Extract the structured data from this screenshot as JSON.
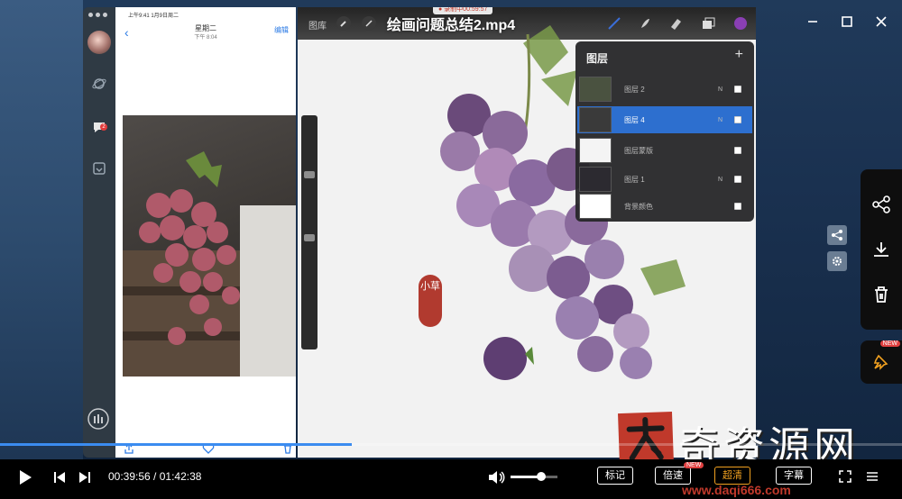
{
  "window": {
    "title": "绘画问题总结2.mp4",
    "controls": [
      "minimize-icon",
      "maximize-icon",
      "close-icon"
    ]
  },
  "ipad": {
    "status_bar": "上午9:41  1月9日周二",
    "notes": {
      "back": "‹",
      "date": "星期二",
      "time": "下午 8:04",
      "edit": "编辑"
    }
  },
  "procreate": {
    "gallery": "图库",
    "recording": "● 录制中00:59:57",
    "layers": {
      "title": "图层",
      "add": "+",
      "items": [
        {
          "name": "图层 2",
          "mode": "N",
          "thumb": "#4a5240",
          "active": false
        },
        {
          "name": "图层 4",
          "mode": "N",
          "thumb": "#3a3a3a",
          "active": true
        },
        {
          "name": "图层蒙版",
          "mode": "",
          "thumb": "#f4f4f4",
          "active": false
        },
        {
          "name": "图层 1",
          "mode": "N",
          "thumb": "#2c2a30",
          "active": false
        },
        {
          "name": "背景颜色",
          "mode": "",
          "thumb": "#ffffff",
          "active": false
        }
      ]
    },
    "seal_text": "小草"
  },
  "watermark": {
    "chars": "奇资源网",
    "url": "www.daqi666.com"
  },
  "player": {
    "current_time": "00:39:56",
    "separator": " / ",
    "total_time": "01:42:38",
    "progress": 0.39,
    "volume": 0.65,
    "buttons": {
      "mark": "标记",
      "speed": "倍速",
      "quality": "超清",
      "subtitle": "字幕"
    },
    "new_badge": "NEW",
    "accent_color": "#3b8cf0",
    "quality_color": "#f0a020"
  }
}
